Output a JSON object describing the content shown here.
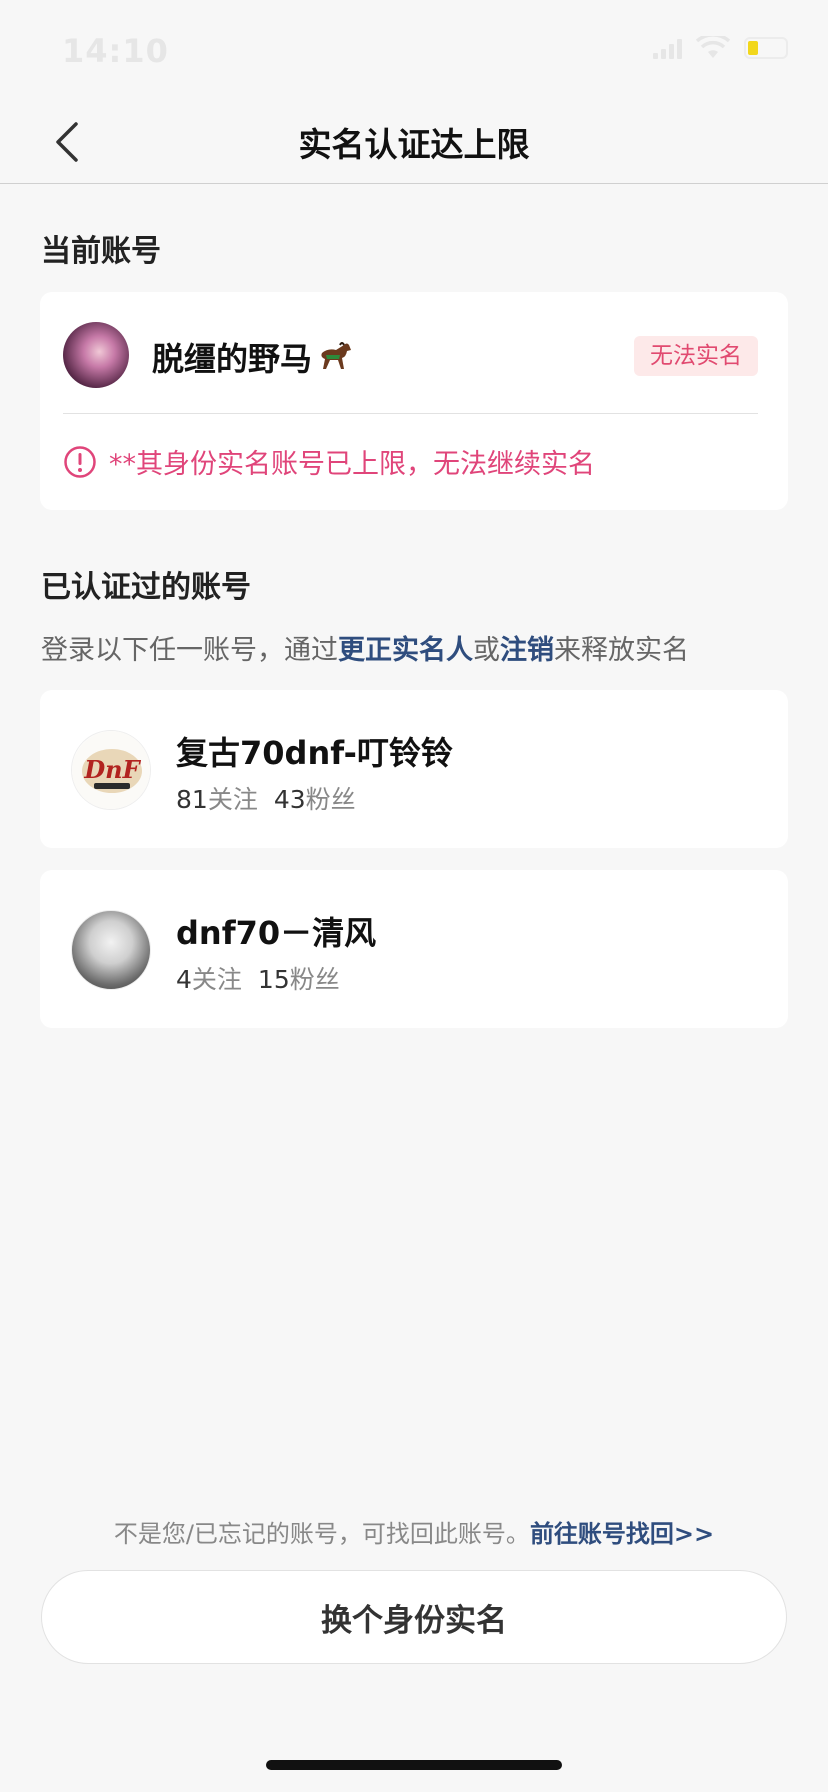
{
  "status_bar": {
    "time": "14:10"
  },
  "nav": {
    "title": "实名认证达上限"
  },
  "current_section": {
    "title": "当前账号",
    "account_name": "脱缰的野马",
    "badge": "无法实名",
    "warning": "**其身份实名账号已上限，无法继续实名"
  },
  "verified_section": {
    "title": "已认证过的账号",
    "desc_prefix": "登录以下任一账号，通过",
    "desc_link1": "更正实名人",
    "desc_mid": "或",
    "desc_link2": "注销",
    "desc_suffix": "来释放实名",
    "accounts": [
      {
        "name": "复古70dnf-叮铃铃",
        "follow_count": "81",
        "follow_label": "关注",
        "fans_count": "43",
        "fans_label": "粉丝"
      },
      {
        "name": "dnf70－清风",
        "follow_count": "4",
        "follow_label": "关注",
        "fans_count": "15",
        "fans_label": "粉丝"
      }
    ]
  },
  "footer": {
    "tip": "不是您/已忘记的账号，可找回此账号。",
    "link": "前往账号找回>>",
    "button": "换个身份实名"
  },
  "colors": {
    "warning": "#e0457a",
    "link": "#2f4d7e",
    "badge_bg": "#fde9e9"
  }
}
